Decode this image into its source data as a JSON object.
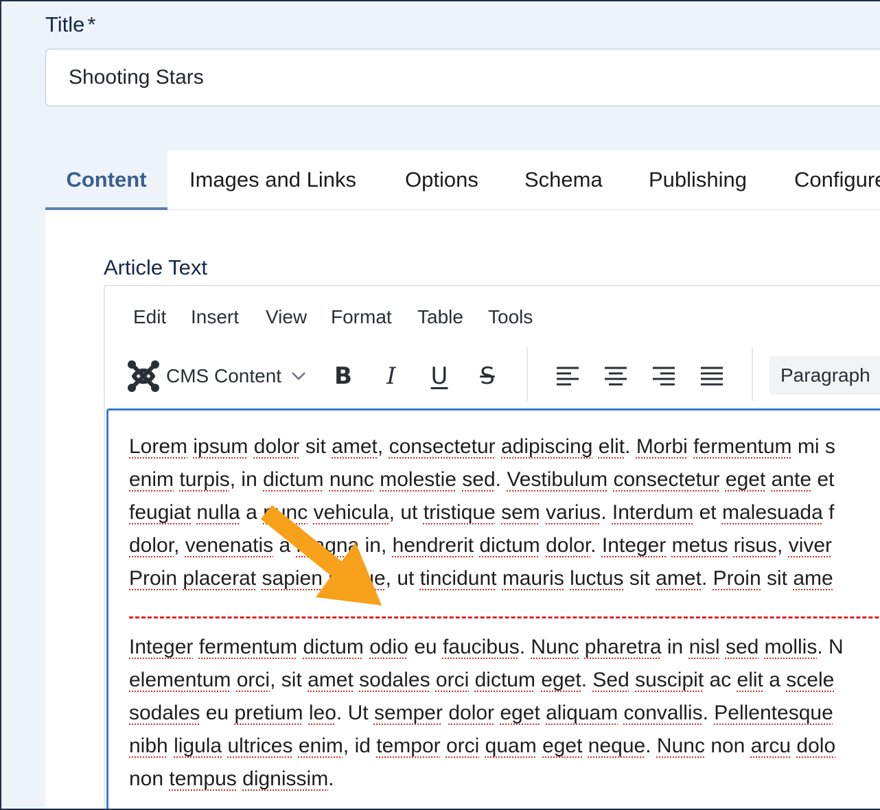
{
  "title_field": {
    "label": "Title",
    "required_mark": "*",
    "value": "Shooting Stars"
  },
  "tabs": [
    {
      "label": "Content",
      "active": true
    },
    {
      "label": "Images and Links"
    },
    {
      "label": "Options"
    },
    {
      "label": "Schema"
    },
    {
      "label": "Publishing"
    },
    {
      "label": "Configure"
    }
  ],
  "article": {
    "label": "Article Text"
  },
  "editor": {
    "menu": [
      "Edit",
      "Insert",
      "View",
      "Format",
      "Table",
      "Tools"
    ],
    "toolbar": {
      "cms_content_label": "CMS Content",
      "cms_icon": "joomla-logo-icon",
      "bold": "B",
      "italic": "I",
      "underline": "U",
      "strikethrough": "S",
      "block_format": "Paragraph"
    },
    "paragraphs": [
      [
        " Lorem ipsum dolor sit amet, consectetur adipiscing elit. Morbi fermentum mi s",
        "enim turpis, in dictum nunc molestie sed. Vestibulum consectetur eget ante et",
        "feugiat nulla a nunc vehicula, ut tristique sem varius. Interdum et malesuada f",
        "dolor, venenatis a magna in, hendrerit dictum dolor. Integer metus risus, viver",
        "Proin placerat sapien neque, ut tincidunt mauris luctus sit amet. Proin sit ame"
      ],
      [
        "Integer fermentum dictum odio eu faucibus. Nunc pharetra in nisl sed mollis. N",
        "elementum orci, sit amet sodales orci dictum eget. Sed suscipit ac elit a scele",
        "sodales eu pretium leo. Ut semper dolor eget aliquam convallis. Pellentesque",
        "nibh ligula ultrices enim, id tempor orci quam eget neque. Nunc non arcu dolo",
        "non tempus dignissim."
      ]
    ]
  },
  "colors": {
    "accent": "#3a7bd5",
    "active_tab_text": "#3a5f8f",
    "readmore_line": "#e02424",
    "annotation_arrow": "#f7a11a"
  }
}
